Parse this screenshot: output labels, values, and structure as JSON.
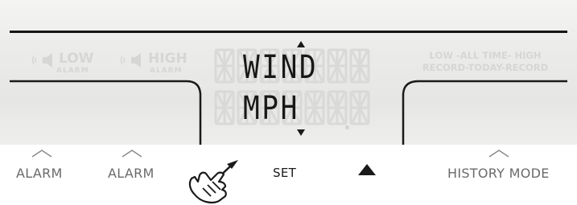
{
  "display": {
    "line1": "WIND",
    "line2": "MPH",
    "ghost": {
      "low_alarm": {
        "main": "LOW",
        "sub": "ALARM"
      },
      "high_alarm": {
        "main": "HIGH",
        "sub": "ALARM"
      },
      "record_row1": "LOW -ALL TIME- HIGH",
      "record_row2": "RECORD-TODAY-RECORD"
    }
  },
  "buttons": {
    "alarm_low": "ALARM",
    "alarm_high": "ALARM",
    "set": "SET",
    "up_arrow": "▲",
    "history_mode": "HISTORY MODE"
  },
  "icons": [
    "speaker-icon",
    "hand-pointer-icon",
    "chevron-up-icon",
    "triangle-up-icon"
  ],
  "colors": {
    "lcd_background": "#ebebea",
    "segment_on": "#181818",
    "segment_ghost": "#d6d6d4",
    "label_grey": "#6a6a6a"
  }
}
